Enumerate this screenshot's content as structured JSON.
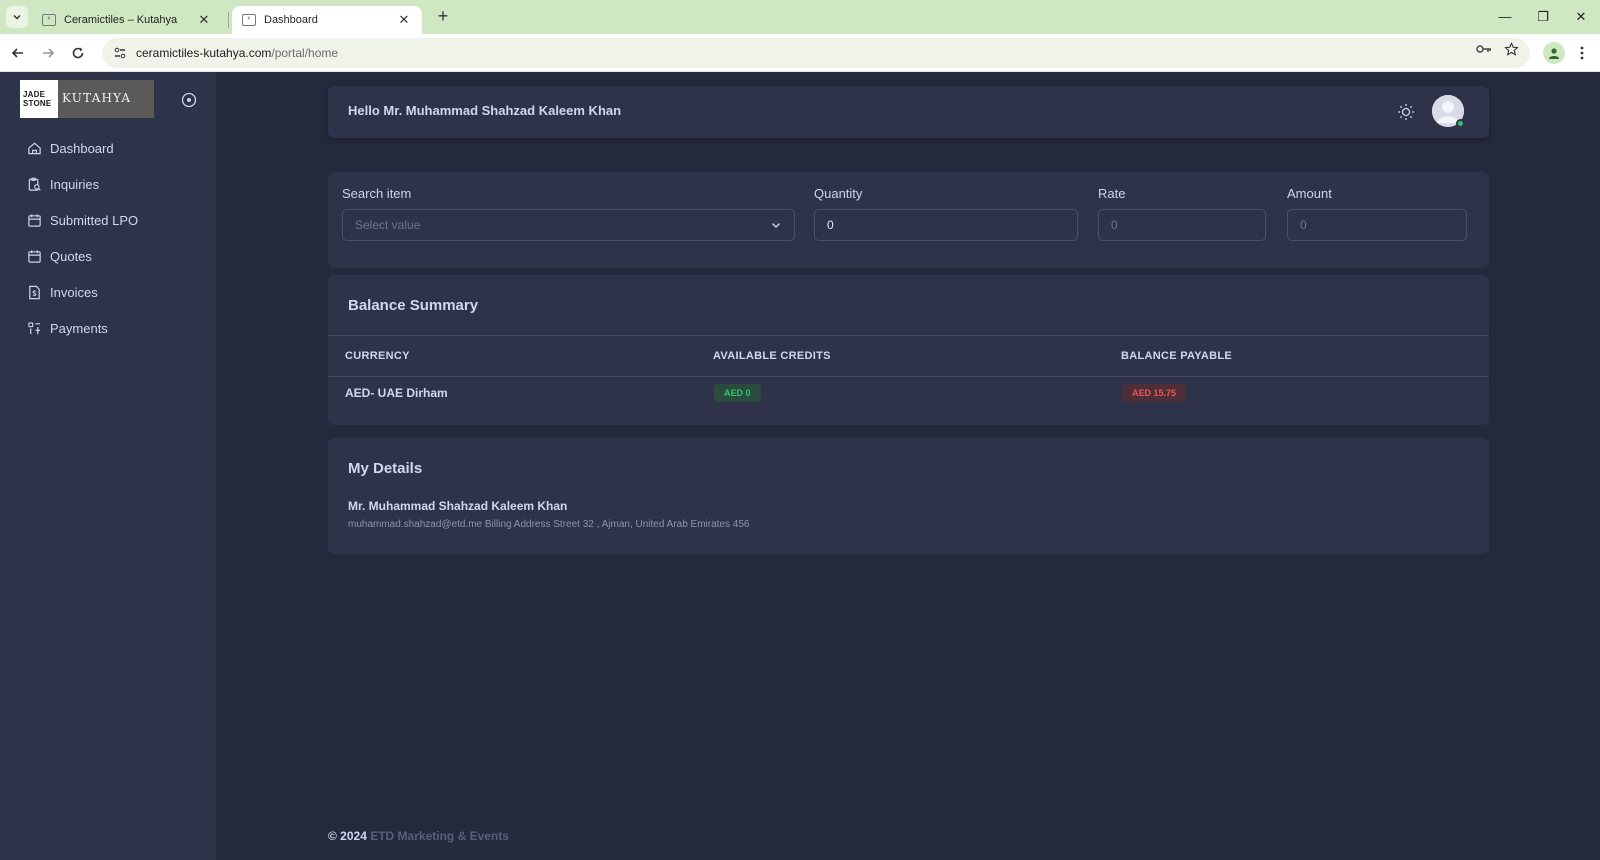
{
  "browser": {
    "tabs": [
      {
        "title": "Ceramictiles – Kutahya",
        "active": false
      },
      {
        "title": "Dashboard",
        "active": true
      }
    ],
    "url_host": "ceramictiles-kutahya.com",
    "url_path": "/portal/home"
  },
  "sidebar": {
    "logo_left": "JADE STONE",
    "logo_right": "KUTAHYA",
    "items": [
      {
        "label": "Dashboard",
        "icon": "home-icon"
      },
      {
        "label": "Inquiries",
        "icon": "clipboard-search-icon"
      },
      {
        "label": "Submitted LPO",
        "icon": "calendar-icon"
      },
      {
        "label": "Quotes",
        "icon": "calendar-icon"
      },
      {
        "label": "Invoices",
        "icon": "invoice-dollar-icon"
      },
      {
        "label": "Payments",
        "icon": "payments-icon"
      }
    ]
  },
  "header": {
    "greeting": "Hello Mr. Muhammad Shahzad Kaleem Khan"
  },
  "search": {
    "item_label": "Search item",
    "item_placeholder": "Select value",
    "quantity_label": "Quantity",
    "quantity_value": "0",
    "rate_label": "Rate",
    "rate_placeholder": "0",
    "amount_label": "Amount",
    "amount_placeholder": "0"
  },
  "balance": {
    "title": "Balance Summary",
    "columns": [
      "CURRENCY",
      "AVAILABLE CREDITS",
      "BALANCE PAYABLE"
    ],
    "rows": [
      {
        "currency": "AED- UAE Dirham",
        "credits": "AED 0",
        "payable": "AED 15.75"
      }
    ]
  },
  "details": {
    "title": "My Details",
    "name": "Mr. Muhammad Shahzad Kaleem Khan",
    "info": "muhammad.shahzad@etd.me Billing Address Street 32 , Ajman, United Arab Emirates 456"
  },
  "footer": {
    "copyright": "© 2024",
    "brand": "ETD Marketing & Events"
  },
  "colors": {
    "background": "#25293c",
    "card": "#2f3349",
    "success": "#28c76f",
    "danger": "#ea5455",
    "browser_frame": "#cfe8c2"
  }
}
